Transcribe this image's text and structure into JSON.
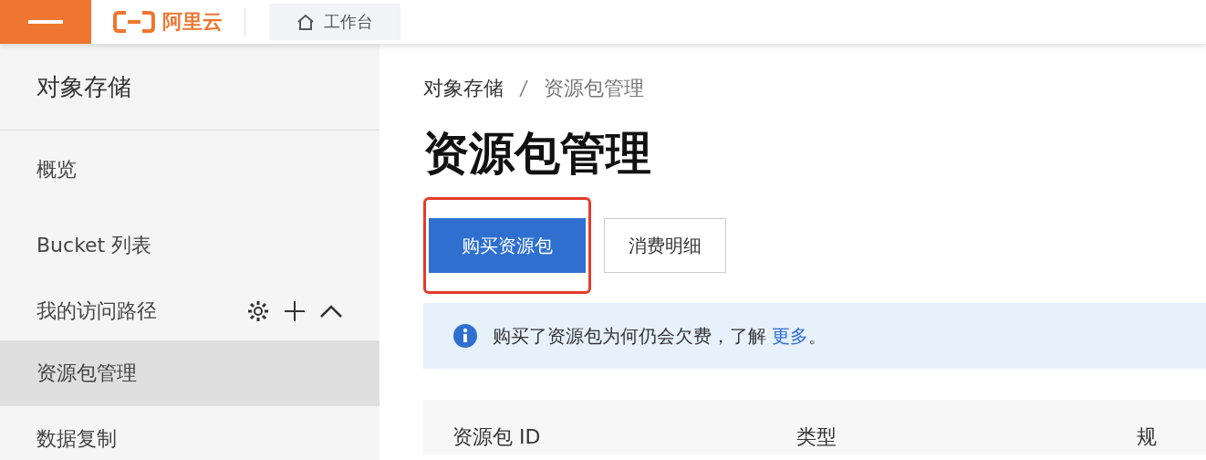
{
  "top_bar": {
    "logo": "阿里云",
    "workbench_tab": "工作台"
  },
  "sidebar": {
    "title": "对象存储",
    "items": [
      {
        "kind": "link",
        "label": "概览",
        "selected": false
      },
      {
        "kind": "link",
        "label": "Bucket 列表",
        "selected": false
      },
      {
        "kind": "group",
        "label": "我的访问路径",
        "expanded": true
      },
      {
        "kind": "link",
        "label": "资源包管理",
        "selected": true
      },
      {
        "kind": "link",
        "label": "数据复制",
        "selected": false
      }
    ]
  },
  "breadcrumb": [
    "对象存储",
    "资源包管理"
  ],
  "page_title": "资源包管理",
  "buttons": [
    {
      "label": "购买资源包",
      "kind": "primary",
      "highlighted": true
    },
    {
      "label": "消费明细",
      "kind": "secondary",
      "highlighted": false
    }
  ],
  "alert": {
    "text": "购买了资源包为何仍会欠费，了解",
    "link": "更多",
    "suffix": "。"
  },
  "table": {
    "columns": [
      "资源包 ID",
      "类型",
      "规"
    ]
  }
}
